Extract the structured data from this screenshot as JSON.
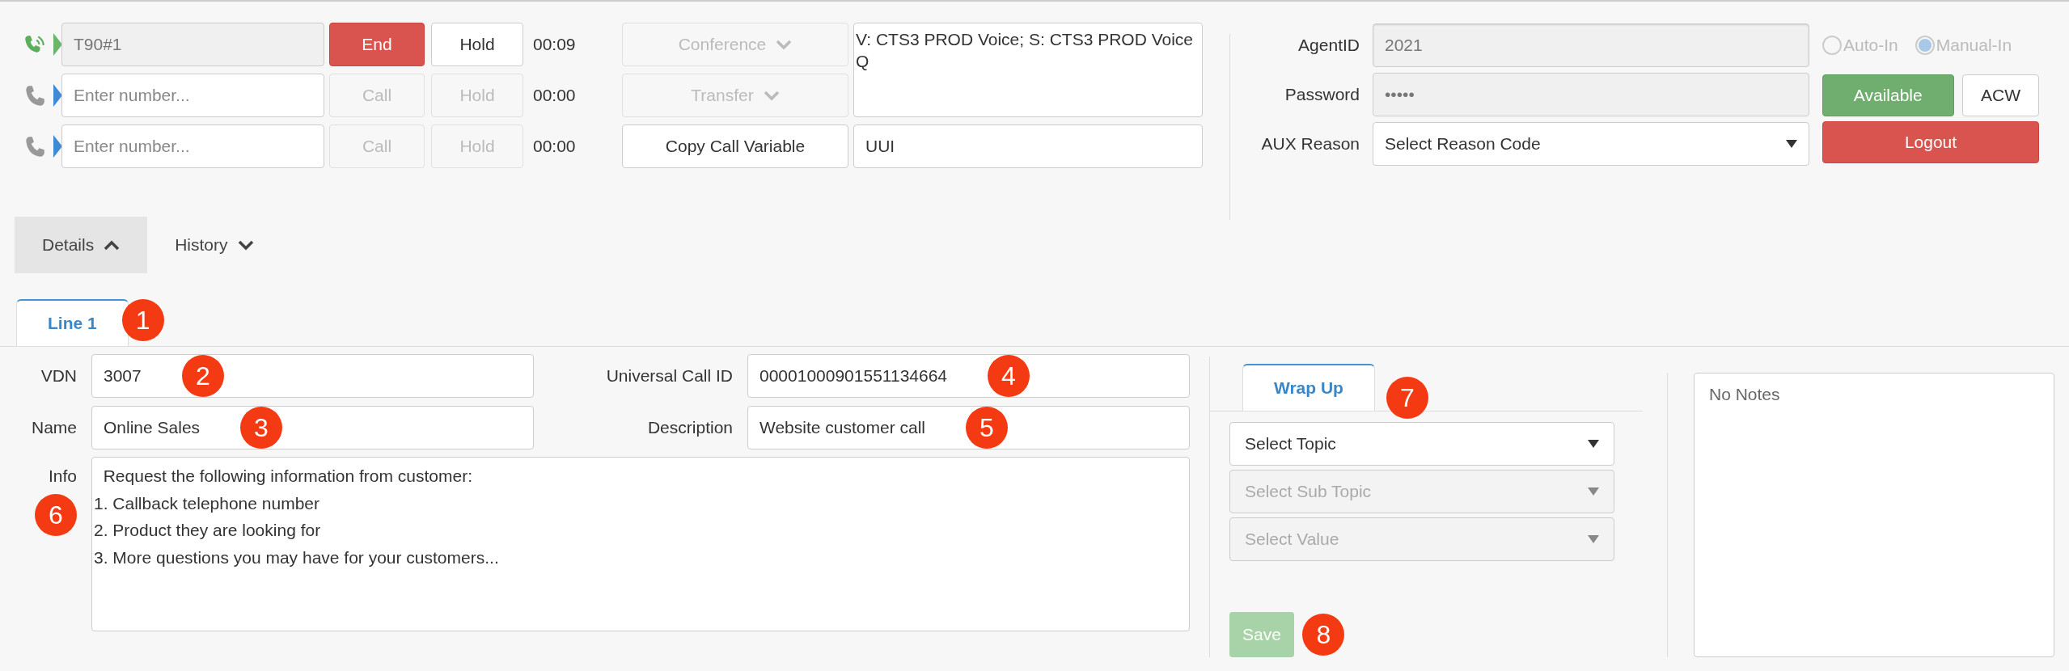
{
  "call_lines": [
    {
      "active": true,
      "value": "T90#1",
      "buttons": [
        {
          "label": "End",
          "kind": "end",
          "disabled": false
        },
        {
          "label": "Hold",
          "kind": "hold",
          "disabled": false
        }
      ],
      "timer": "00:09"
    },
    {
      "active": false,
      "placeholder": "Enter number...",
      "buttons": [
        {
          "label": "Call",
          "kind": "call",
          "disabled": true
        },
        {
          "label": "Hold",
          "kind": "hold",
          "disabled": true
        }
      ],
      "timer": "00:00"
    },
    {
      "active": false,
      "placeholder": "Enter number...",
      "buttons": [
        {
          "label": "Call",
          "kind": "call",
          "disabled": true
        },
        {
          "label": "Hold",
          "kind": "hold",
          "disabled": true
        }
      ],
      "timer": "00:00"
    }
  ],
  "call_actions": [
    {
      "label": "Conference",
      "disabled": true
    },
    {
      "label": "Transfer",
      "disabled": true
    }
  ],
  "copy_button": {
    "label": "Copy Call Variable"
  },
  "call_info": "V: CTS3 PROD Voice; S: CTS3 PROD Voice Q",
  "uui": "UUI",
  "agent": {
    "fields": [
      {
        "label": "AgentID",
        "value": "2021",
        "disabled": true
      },
      {
        "label": "Password",
        "value": "•••••",
        "disabled": true
      }
    ],
    "aux": {
      "label": "AUX Reason",
      "value": "Select Reason Code"
    },
    "modes": [
      {
        "label": "Auto-In",
        "selected": false
      },
      {
        "label": "Manual-In",
        "selected": true
      }
    ],
    "buttons": [
      {
        "label": "Available",
        "kind": "available"
      },
      {
        "label": "ACW",
        "kind": "acw"
      },
      {
        "label": "Logout",
        "kind": "logout"
      }
    ]
  },
  "sections": [
    {
      "label": "Details",
      "selected": true,
      "expanded": true
    },
    {
      "label": "History",
      "selected": false,
      "expanded": false
    }
  ],
  "line_tabs": [
    {
      "label": "Line 1",
      "selected": true,
      "marker": "1"
    }
  ],
  "details": [
    {
      "label": "VDN",
      "value": "3007",
      "marker": "2"
    },
    {
      "label": "Universal Call ID",
      "value": "00001000901551134664",
      "marker": "4"
    },
    {
      "label": "Name",
      "value": "Online Sales",
      "marker": "3"
    },
    {
      "label": "Description",
      "value": "Website customer call",
      "marker": "5"
    }
  ],
  "info": {
    "label": "Info",
    "marker": "6",
    "value": "  Request the following information from customer:\n1. Callback telephone number\n2. Product they are looking for\n3. More questions you may have for your customers..."
  },
  "wrap_up": {
    "tab": {
      "label": "Wrap Up",
      "selected": true,
      "marker": "7"
    },
    "selects": [
      {
        "placeholder": "Select Topic",
        "disabled": false
      },
      {
        "placeholder": "Select Sub Topic",
        "disabled": true
      },
      {
        "placeholder": "Select Value",
        "disabled": true
      }
    ],
    "save": {
      "label": "Save",
      "disabled": true,
      "marker": "8"
    },
    "notes": "No Notes"
  }
}
